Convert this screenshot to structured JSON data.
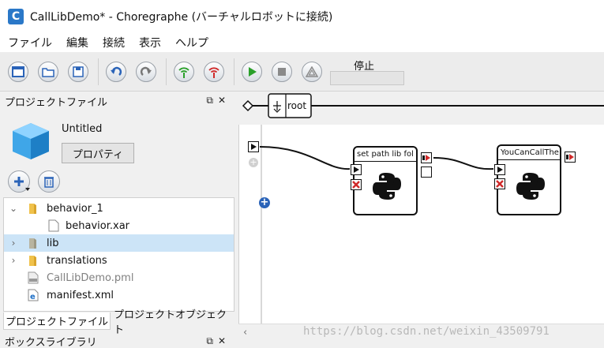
{
  "window": {
    "title": "CallLibDemo* - Choregraphe (バーチャルロボットに接続)",
    "logo_letter": "C"
  },
  "menu": [
    "ファイル",
    "編集",
    "接続",
    "表示",
    "ヘルプ"
  ],
  "toolbar": {
    "buttons": [
      {
        "name": "new-project-icon",
        "color": "#2a63b8"
      },
      {
        "name": "open-project-icon",
        "color": "#2a63b8"
      },
      {
        "name": "save-project-icon",
        "color": "#2a63b8"
      },
      {
        "name": "undo-icon",
        "color": "#2a63b8"
      },
      {
        "name": "redo-icon",
        "color": "#777777"
      },
      {
        "name": "connect-icon",
        "color": "#2aa02a"
      },
      {
        "name": "disconnect-icon",
        "color": "#d02a2a"
      },
      {
        "name": "play-icon",
        "color": "#2aa02a"
      },
      {
        "name": "stop-icon",
        "color": "#8a8a8a"
      },
      {
        "name": "debug-icon",
        "color": "#8a8a8a"
      }
    ],
    "status_label": "停止"
  },
  "project_panel": {
    "title": "プロジェクトファイル",
    "project_name": "Untitled",
    "properties_button": "プロパティ",
    "tree": [
      {
        "label": "behavior_1",
        "type": "folder",
        "expanded": true
      },
      {
        "label": "behavior.xar",
        "type": "file"
      },
      {
        "label": "lib",
        "type": "folder",
        "expanded": false,
        "selected": true
      },
      {
        "label": "translations",
        "type": "folder",
        "expanded": false
      },
      {
        "label": "CallLibDemo.pml",
        "type": "pml",
        "muted": true
      },
      {
        "label": "manifest.xml",
        "type": "xml"
      }
    ],
    "tabs": [
      "プロジェクトファイル",
      "プロジェクトオブジェクト"
    ]
  },
  "box_library_panel": {
    "title": "ボックスライブラリ"
  },
  "diagram": {
    "breadcrumb_root": "root",
    "boxes": [
      {
        "title": "set path lib fol"
      },
      {
        "title": "YouCanCallThe"
      }
    ]
  },
  "watermark": "https://blog.csdn.net/weixin_43509791"
}
